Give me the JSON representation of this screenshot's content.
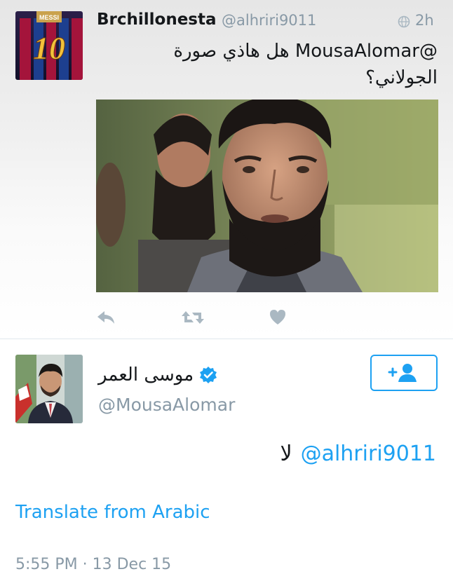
{
  "quoted_tweet": {
    "author_name": "Brchillonesta",
    "handle": "@alhriri9011",
    "time_ago": "2h",
    "text_line1": "@MousaAlomar هل هاذي صورة",
    "text_line2": "الجولاني؟",
    "avatar_jersey_text": "MESSI",
    "avatar_jersey_number": "10",
    "actions": [
      "reply-icon",
      "retweet-icon",
      "like-icon"
    ]
  },
  "reply_tweet": {
    "author_name": "موسى العمر",
    "handle": "@MousaAlomar",
    "verified": true,
    "reply_mention": "@alhriri9011",
    "reply_text": "لا",
    "translate_label": "Translate from Arabic",
    "timestamp": "5:55 PM · 13 Dec 15",
    "follow_icon": "add-user-icon"
  },
  "colors": {
    "link": "#1da1f2",
    "secondary_text": "#8899a6",
    "primary_text": "#14171a",
    "action_icon": "#aab8c2"
  }
}
